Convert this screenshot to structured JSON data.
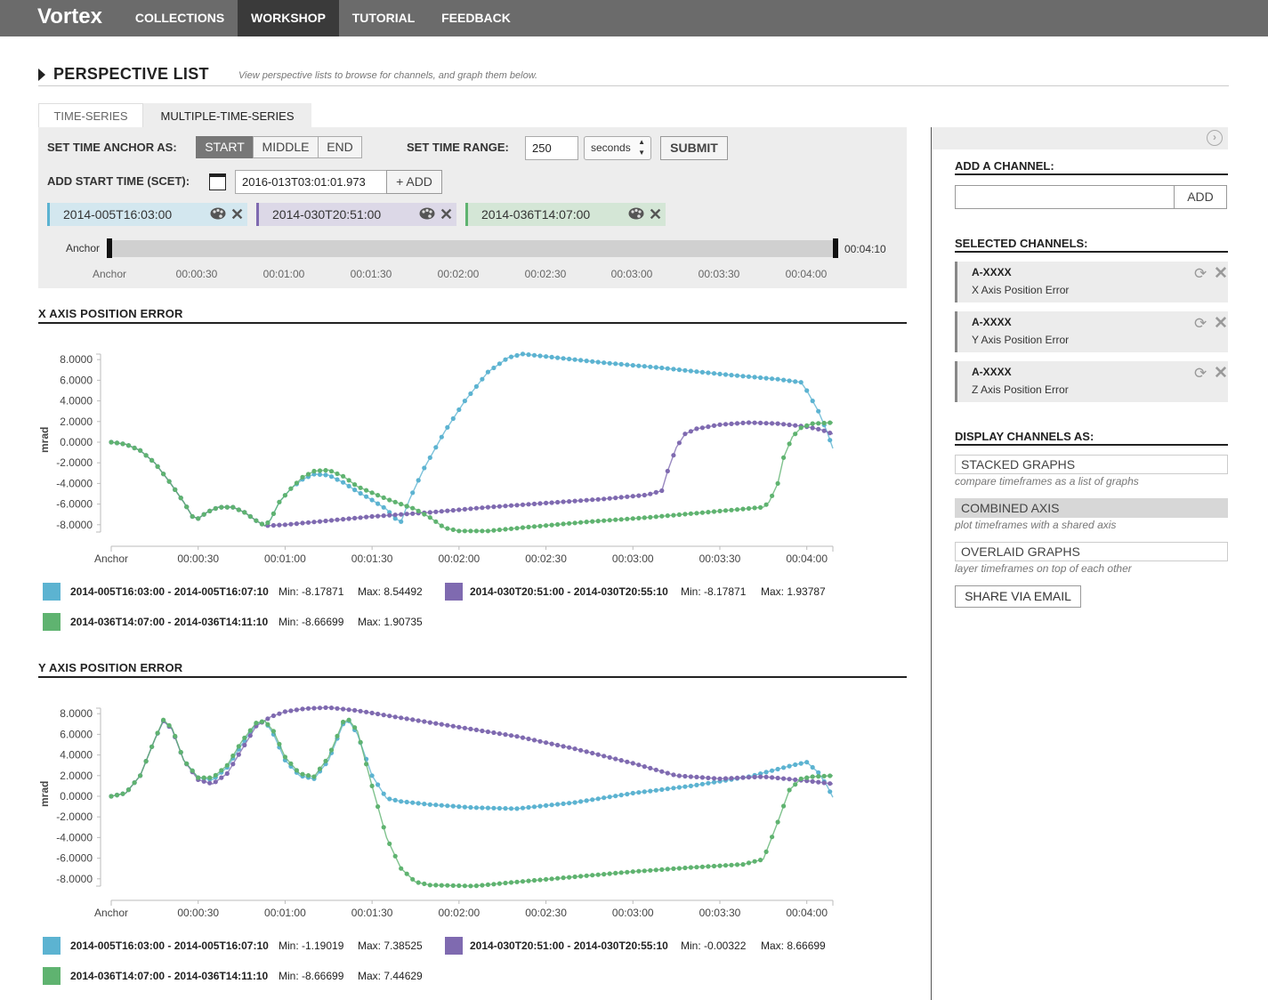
{
  "app": {
    "brand": "Vortex"
  },
  "nav": [
    {
      "label": "COLLECTIONS",
      "active": false
    },
    {
      "label": "WORKSHOP",
      "active": true
    },
    {
      "label": "TUTORIAL",
      "active": false
    },
    {
      "label": "FEEDBACK",
      "active": false
    }
  ],
  "perspective": {
    "title": "PERSPECTIVE LIST",
    "subtitle": "View perspective lists to browse for channels, and graph them below."
  },
  "tabs": [
    {
      "label": "TIME-SERIES",
      "active": false
    },
    {
      "label": "MULTIPLE-TIME-SERIES",
      "active": true
    }
  ],
  "controls": {
    "anchor_label": "SET TIME ANCHOR AS:",
    "anchor_options": [
      "START",
      "MIDDLE",
      "END"
    ],
    "anchor_selected": "START",
    "range_label": "SET TIME RANGE:",
    "range_value": "250",
    "range_unit": "seconds",
    "submit_label": "SUBMIT",
    "start_time_label": "ADD START TIME (SCET):",
    "start_time_value": "2016-013T03:01:01.973",
    "add_label": "+ ADD"
  },
  "timeframes": [
    {
      "label": "2014-005T16:03:00",
      "color": "#5cb3d1",
      "bg": "#d3e7ef"
    },
    {
      "label": "2014-030T20:51:00",
      "color": "#7f6ab0",
      "bg": "#dcd8e7"
    },
    {
      "label": "2014-036T14:07:00",
      "color": "#5fb370",
      "bg": "#d4e6d6"
    }
  ],
  "slider": {
    "start_label": "Anchor",
    "end_label": "00:04:10",
    "ticks": [
      "Anchor",
      "00:00:30",
      "00:01:00",
      "00:01:30",
      "00:02:00",
      "00:02:30",
      "00:03:00",
      "00:03:30",
      "00:04:00"
    ]
  },
  "chart_data": [
    {
      "type": "line",
      "title": "X AXIS POSITION ERROR",
      "ylabel": "mrad",
      "xlabel": "",
      "ylim": [
        -8.5,
        8.5
      ],
      "yticks": [
        "8.0000",
        "6.0000",
        "4.0000",
        "2.0000",
        "0.0000",
        "-2.0000",
        "-4.0000",
        "-6.0000",
        "-8.0000"
      ],
      "xticks": [
        "Anchor",
        "00:00:30",
        "00:01:00",
        "00:01:30",
        "00:02:00",
        "00:02:30",
        "00:03:00",
        "00:03:30",
        "00:04:00"
      ],
      "x_unit": "seconds",
      "series": [
        {
          "name": "2014-005T16:03:00 - 2014-005T16:07:10",
          "color": "#5cb3d1",
          "min_text": "Min: -8.17871",
          "max_text": "Max: 8.54492",
          "points": [
            [
              0,
              0
            ],
            [
              5,
              -0.2
            ],
            [
              10,
              -0.8
            ],
            [
              15,
              -2
            ],
            [
              20,
              -3.8
            ],
            [
              25,
              -5.8
            ],
            [
              28,
              -7.2
            ],
            [
              30,
              -7.4
            ],
            [
              33,
              -6.8
            ],
            [
              37,
              -6.3
            ],
            [
              42,
              -6.3
            ],
            [
              46,
              -6.8
            ],
            [
              50,
              -7.6
            ],
            [
              53,
              -8.1
            ],
            [
              55,
              -7.5
            ],
            [
              58,
              -5.8
            ],
            [
              62,
              -4.5
            ],
            [
              66,
              -3.6
            ],
            [
              70,
              -3.1
            ],
            [
              75,
              -3.2
            ],
            [
              80,
              -3.9
            ],
            [
              85,
              -4.8
            ],
            [
              90,
              -5.6
            ],
            [
              95,
              -6.5
            ],
            [
              98,
              -7.4
            ],
            [
              100,
              -7.7
            ],
            [
              103,
              -5.5
            ],
            [
              108,
              -2.5
            ],
            [
              115,
              1.0
            ],
            [
              122,
              4.0
            ],
            [
              130,
              6.8
            ],
            [
              137,
              8.2
            ],
            [
              142,
              8.54
            ],
            [
              150,
              8.3
            ],
            [
              170,
              7.7
            ],
            [
              190,
              7.2
            ],
            [
              210,
              6.6
            ],
            [
              230,
              6.1
            ],
            [
              238,
              5.8
            ],
            [
              240,
              5.0
            ],
            [
              244,
              3.0
            ],
            [
              247,
              1.0
            ],
            [
              249,
              -0.6
            ]
          ]
        },
        {
          "name": "2014-030T20:51:00 - 2014-030T20:55:10",
          "color": "#7f6ab0",
          "min_text": "Min: -8.17871",
          "max_text": "Max: 1.93787",
          "points": [
            [
              0,
              0
            ],
            [
              5,
              -0.2
            ],
            [
              10,
              -0.8
            ],
            [
              15,
              -2
            ],
            [
              20,
              -3.8
            ],
            [
              25,
              -5.8
            ],
            [
              28,
              -7.2
            ],
            [
              30,
              -7.4
            ],
            [
              33,
              -6.8
            ],
            [
              37,
              -6.3
            ],
            [
              42,
              -6.3
            ],
            [
              46,
              -6.8
            ],
            [
              50,
              -7.6
            ],
            [
              53,
              -8.1
            ],
            [
              60,
              -8.0
            ],
            [
              75,
              -7.6
            ],
            [
              90,
              -7.2
            ],
            [
              110,
              -6.8
            ],
            [
              130,
              -6.3
            ],
            [
              150,
              -5.9
            ],
            [
              170,
              -5.5
            ],
            [
              185,
              -5.1
            ],
            [
              190,
              -4.7
            ],
            [
              192,
              -2.8
            ],
            [
              195,
              -0.5
            ],
            [
              198,
              0.8
            ],
            [
              202,
              1.3
            ],
            [
              210,
              1.7
            ],
            [
              220,
              1.9
            ],
            [
              230,
              1.8
            ],
            [
              240,
              1.5
            ],
            [
              245,
              1.2
            ],
            [
              249,
              0.8
            ]
          ]
        },
        {
          "name": "2014-036T14:07:00 - 2014-036T14:11:10",
          "color": "#5fb370",
          "min_text": "Min: -8.66699",
          "max_text": "Max: 1.90735",
          "points": [
            [
              0,
              0
            ],
            [
              5,
              -0.2
            ],
            [
              10,
              -0.8
            ],
            [
              15,
              -2
            ],
            [
              20,
              -3.8
            ],
            [
              25,
              -5.8
            ],
            [
              28,
              -7.2
            ],
            [
              30,
              -7.4
            ],
            [
              33,
              -6.8
            ],
            [
              37,
              -6.3
            ],
            [
              42,
              -6.3
            ],
            [
              46,
              -6.8
            ],
            [
              50,
              -7.6
            ],
            [
              53,
              -8.1
            ],
            [
              55,
              -7.5
            ],
            [
              58,
              -5.8
            ],
            [
              62,
              -4.5
            ],
            [
              66,
              -3.4
            ],
            [
              70,
              -2.8
            ],
            [
              75,
              -2.7
            ],
            [
              80,
              -3.3
            ],
            [
              85,
              -4.3
            ],
            [
              90,
              -4.9
            ],
            [
              95,
              -5.5
            ],
            [
              100,
              -6.0
            ],
            [
              105,
              -6.5
            ],
            [
              110,
              -7.3
            ],
            [
              115,
              -8.3
            ],
            [
              120,
              -8.6
            ],
            [
              130,
              -8.6
            ],
            [
              145,
              -8.2
            ],
            [
              165,
              -7.7
            ],
            [
              185,
              -7.3
            ],
            [
              205,
              -6.8
            ],
            [
              225,
              -6.3
            ],
            [
              227,
              -5.8
            ],
            [
              230,
              -4.0
            ],
            [
              232,
              -1.5
            ],
            [
              235,
              0.5
            ],
            [
              238,
              1.4
            ],
            [
              242,
              1.8
            ],
            [
              249,
              1.9
            ]
          ]
        }
      ]
    },
    {
      "type": "line",
      "title": "Y AXIS POSITION ERROR",
      "ylabel": "mrad",
      "xlabel": "",
      "ylim": [
        -8.5,
        8.5
      ],
      "yticks": [
        "8.0000",
        "6.0000",
        "4.0000",
        "2.0000",
        "0.0000",
        "-2.0000",
        "-4.0000",
        "-6.0000",
        "-8.0000"
      ],
      "xticks": [
        "Anchor",
        "00:00:30",
        "00:01:00",
        "00:01:30",
        "00:02:00",
        "00:02:30",
        "00:03:00",
        "00:03:30",
        "00:04:00"
      ],
      "x_unit": "seconds",
      "series": [
        {
          "name": "2014-005T16:03:00 - 2014-005T16:07:10",
          "color": "#5cb3d1",
          "min_text": "Min: -1.19019",
          "max_text": "Max: 7.38525",
          "points": [
            [
              0,
              0
            ],
            [
              5,
              0.3
            ],
            [
              10,
              2
            ],
            [
              15,
              5.5
            ],
            [
              18,
              7.3
            ],
            [
              21,
              6.5
            ],
            [
              25,
              3.5
            ],
            [
              30,
              1.8
            ],
            [
              35,
              1.6
            ],
            [
              40,
              2.8
            ],
            [
              45,
              5.0
            ],
            [
              50,
              7.0
            ],
            [
              53,
              7.3
            ],
            [
              56,
              6.0
            ],
            [
              60,
              3.5
            ],
            [
              65,
              2.0
            ],
            [
              70,
              1.7
            ],
            [
              75,
              3.5
            ],
            [
              80,
              7.0
            ],
            [
              82,
              7.3
            ],
            [
              85,
              6.0
            ],
            [
              90,
              2.0
            ],
            [
              95,
              -0.2
            ],
            [
              100,
              -0.5
            ],
            [
              110,
              -0.8
            ],
            [
              125,
              -1.1
            ],
            [
              140,
              -1.2
            ],
            [
              160,
              -0.6
            ],
            [
              180,
              0.3
            ],
            [
              200,
              1.0
            ],
            [
              220,
              1.9
            ],
            [
              235,
              3.0
            ],
            [
              240,
              3.3
            ],
            [
              244,
              2.3
            ],
            [
              247,
              1.0
            ],
            [
              249,
              -0.1
            ]
          ]
        },
        {
          "name": "2014-030T20:51:00 - 2014-030T20:55:10",
          "color": "#7f6ab0",
          "min_text": "Min: -0.00322",
          "max_text": "Max: 8.66699",
          "points": [
            [
              0,
              0
            ],
            [
              5,
              0.3
            ],
            [
              10,
              2
            ],
            [
              15,
              5.5
            ],
            [
              18,
              7.3
            ],
            [
              21,
              6.5
            ],
            [
              25,
              3.5
            ],
            [
              30,
              1.6
            ],
            [
              35,
              1.2
            ],
            [
              40,
              2.2
            ],
            [
              45,
              4.5
            ],
            [
              50,
              6.8
            ],
            [
              55,
              7.7
            ],
            [
              60,
              8.2
            ],
            [
              67,
              8.5
            ],
            [
              75,
              8.6
            ],
            [
              85,
              8.3
            ],
            [
              100,
              7.6
            ],
            [
              120,
              6.7
            ],
            [
              140,
              5.8
            ],
            [
              160,
              4.6
            ],
            [
              180,
              3.2
            ],
            [
              195,
              2.0
            ],
            [
              210,
              1.7
            ],
            [
              225,
              1.9
            ],
            [
              240,
              1.5
            ],
            [
              249,
              1.2
            ]
          ]
        },
        {
          "name": "2014-036T14:07:00 - 2014-036T14:11:10",
          "color": "#5fb370",
          "min_text": "Min: -8.66699",
          "max_text": "Max: 7.44629",
          "points": [
            [
              0,
              0
            ],
            [
              5,
              0.3
            ],
            [
              10,
              2
            ],
            [
              15,
              5.5
            ],
            [
              18,
              7.4
            ],
            [
              21,
              6.6
            ],
            [
              25,
              3.5
            ],
            [
              30,
              1.8
            ],
            [
              35,
              1.8
            ],
            [
              40,
              3.0
            ],
            [
              45,
              5.3
            ],
            [
              50,
              7.1
            ],
            [
              53,
              7.3
            ],
            [
              56,
              6.3
            ],
            [
              60,
              3.8
            ],
            [
              65,
              2.2
            ],
            [
              70,
              1.9
            ],
            [
              75,
              3.8
            ],
            [
              80,
              7.2
            ],
            [
              82,
              7.4
            ],
            [
              85,
              6.3
            ],
            [
              90,
              1.0
            ],
            [
              95,
              -4.0
            ],
            [
              100,
              -7.0
            ],
            [
              105,
              -8.3
            ],
            [
              110,
              -8.6
            ],
            [
              125,
              -8.7
            ],
            [
              140,
              -8.3
            ],
            [
              160,
              -7.8
            ],
            [
              180,
              -7.3
            ],
            [
              200,
              -6.9
            ],
            [
              218,
              -6.6
            ],
            [
              225,
              -6.1
            ],
            [
              230,
              -2.5
            ],
            [
              234,
              0.6
            ],
            [
              238,
              1.7
            ],
            [
              242,
              1.9
            ],
            [
              249,
              2.0
            ]
          ]
        }
      ]
    }
  ],
  "side": {
    "add_channel_title": "ADD A CHANNEL:",
    "add_channel_value": "",
    "add_button": "ADD",
    "selected_title": "SELECTED CHANNELS:",
    "selected": [
      {
        "code": "A-XXXX",
        "name": "X Axis Position Error"
      },
      {
        "code": "A-XXXX",
        "name": "Y Axis Position Error"
      },
      {
        "code": "A-XXXX",
        "name": "Z Axis Position Error"
      }
    ],
    "display_title": "DISPLAY CHANNELS AS:",
    "display_options": [
      {
        "label": "STACKED GRAPHS",
        "desc": "compare timeframes as a list of graphs",
        "active": false
      },
      {
        "label": "COMBINED AXIS",
        "desc": "plot timeframes with a shared axis",
        "active": true
      },
      {
        "label": "OVERLAID GRAPHS",
        "desc": "layer timeframes on top of each other",
        "active": false
      }
    ],
    "share_label": "SHARE VIA EMAIL"
  }
}
